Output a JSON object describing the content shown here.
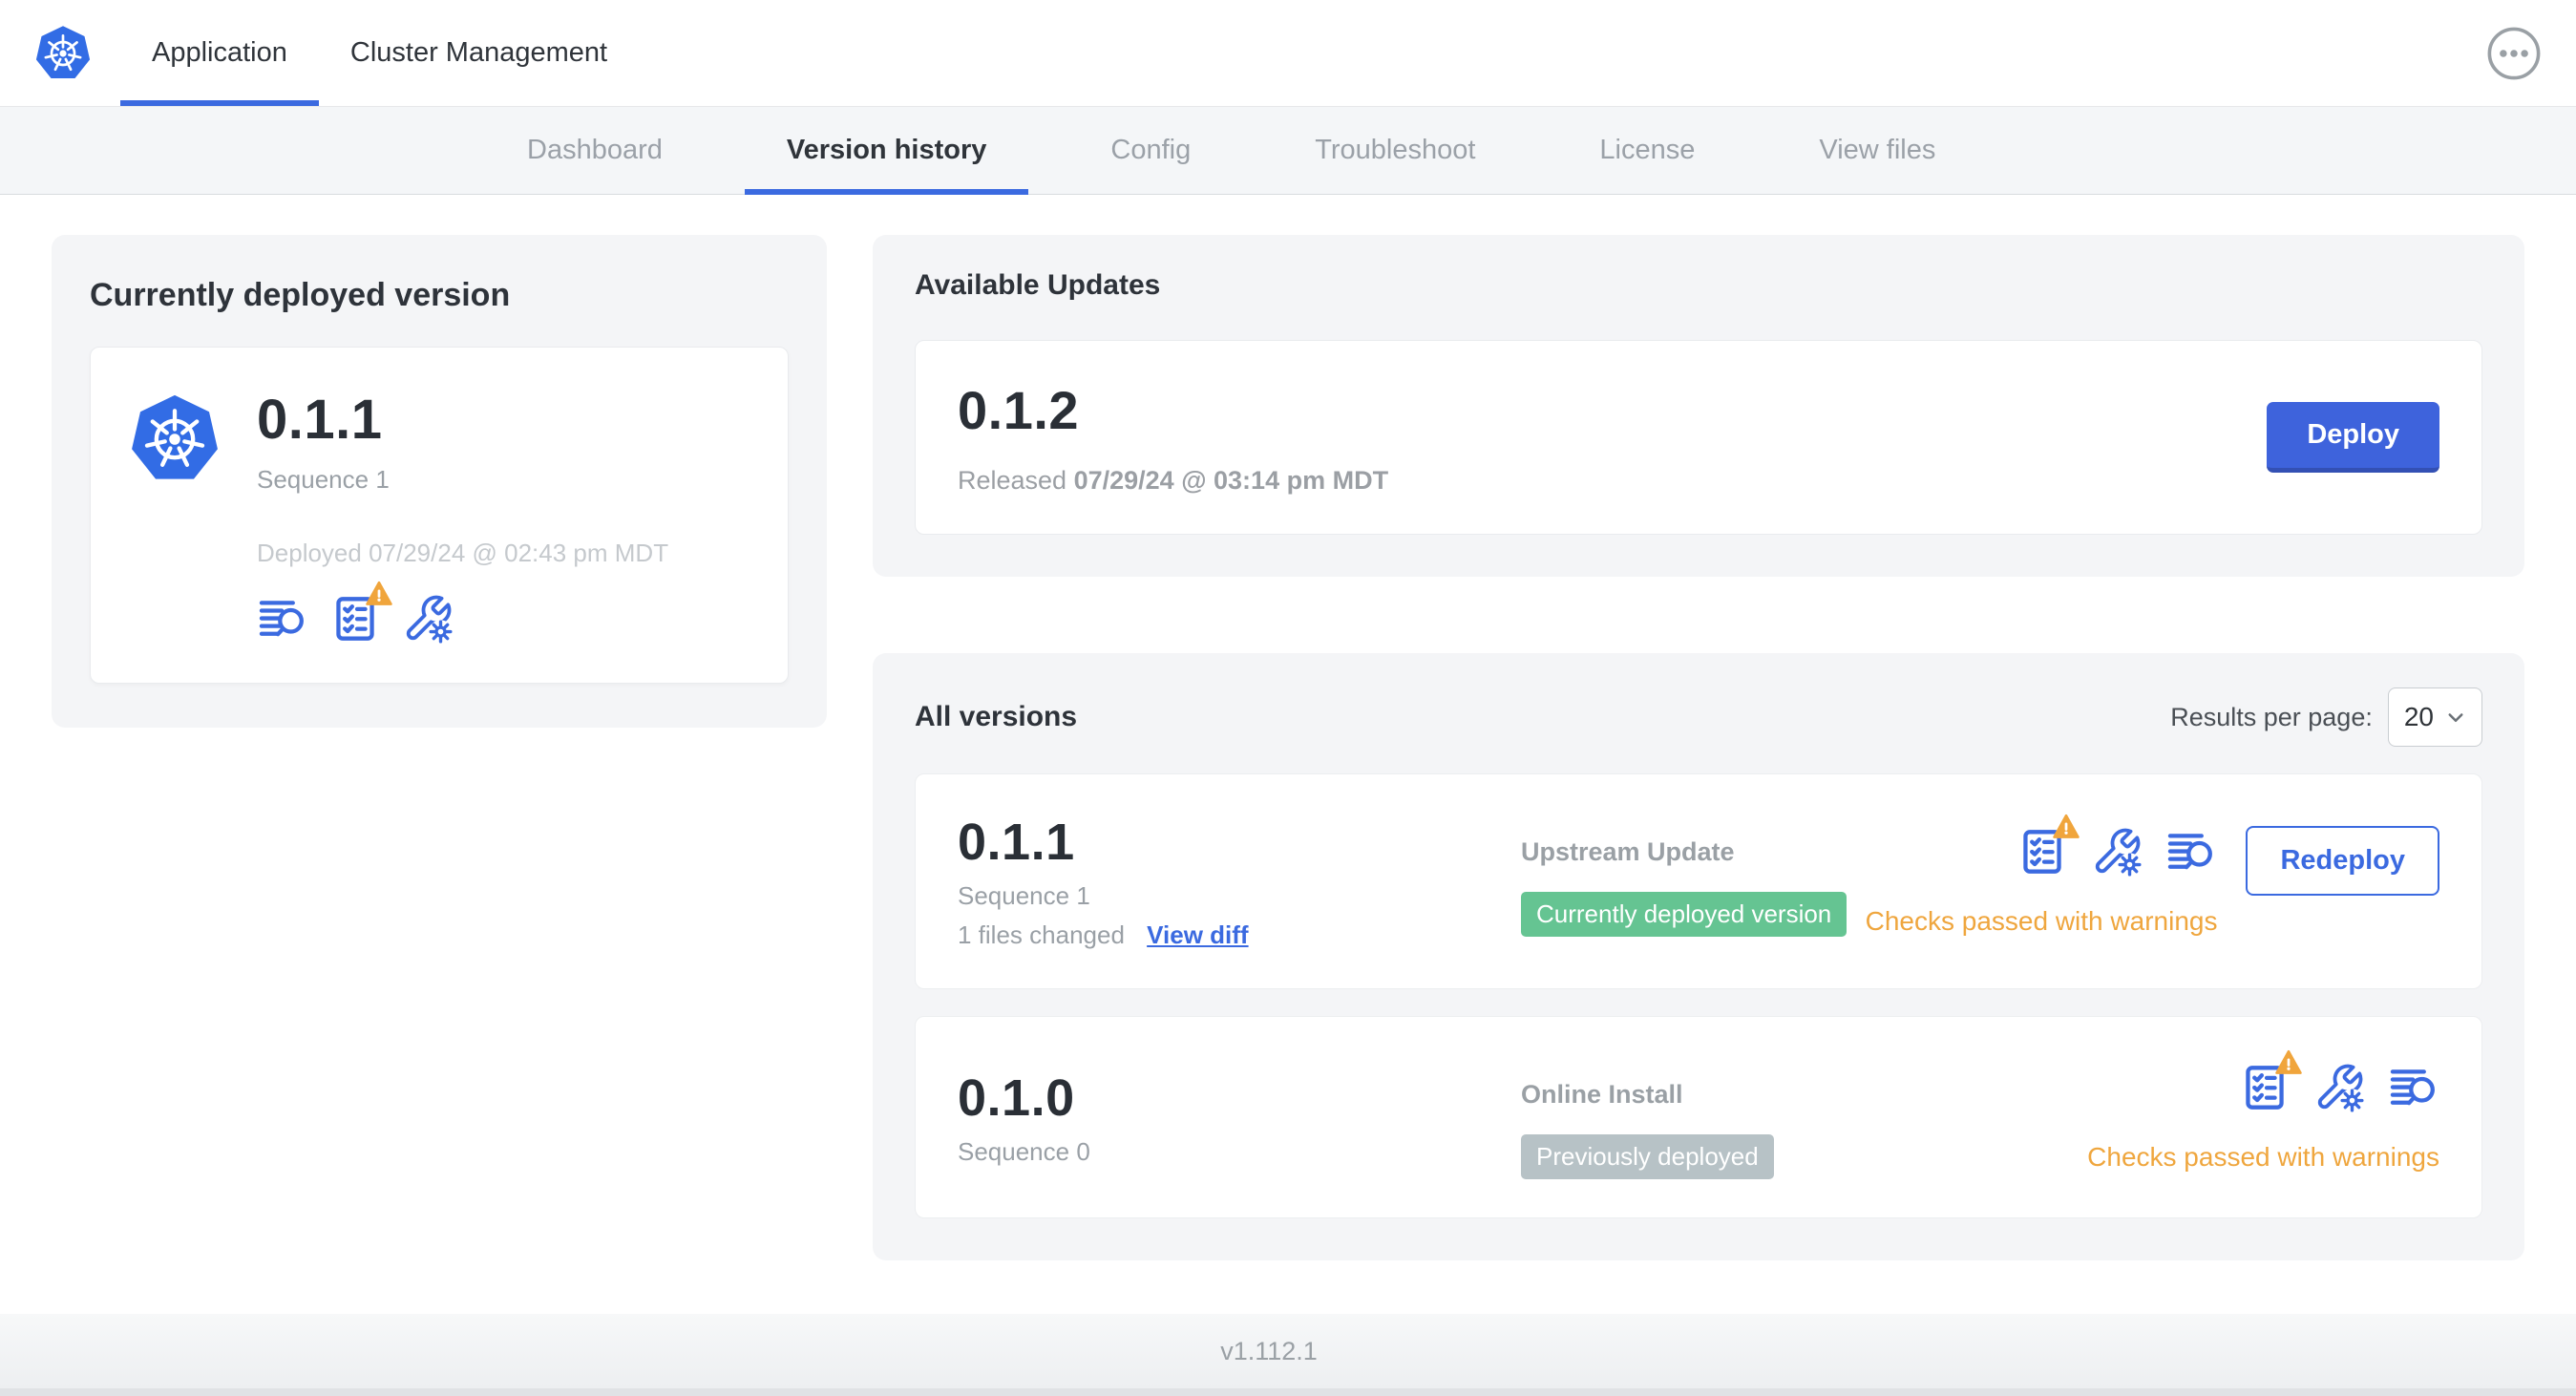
{
  "header": {
    "logo_icon": "kubernetes-logo",
    "tabs": [
      {
        "label": "Application",
        "active": true
      },
      {
        "label": "Cluster Management",
        "active": false
      }
    ],
    "menu_icon": "ellipsis-icon"
  },
  "subnav": {
    "tabs": [
      {
        "label": "Dashboard",
        "active": false
      },
      {
        "label": "Version history",
        "active": true
      },
      {
        "label": "Config",
        "active": false
      },
      {
        "label": "Troubleshoot",
        "active": false
      },
      {
        "label": "License",
        "active": false
      },
      {
        "label": "View files",
        "active": false
      }
    ]
  },
  "current_version_card": {
    "title": "Currently deployed version",
    "version": "0.1.1",
    "sequence": "Sequence 1",
    "deployed_at": "Deployed 07/29/24 @ 02:43 pm MDT",
    "icons": [
      "deploy-logs-icon",
      "preflight-checks-warning-icon",
      "config-icon"
    ]
  },
  "available_updates": {
    "title": "Available Updates",
    "update": {
      "version": "0.1.2",
      "released_label": "Released",
      "released_date": "07/29/24 @ 03:14 pm MDT",
      "deploy_label": "Deploy"
    }
  },
  "all_versions": {
    "title": "All versions",
    "results_per_page_label": "Results per page:",
    "results_per_page_value": "20",
    "versions": [
      {
        "version": "0.1.1",
        "sequence": "Sequence 1",
        "files_changed": "1 files changed",
        "view_diff_label": "View diff",
        "source": "Upstream Update",
        "status_badge": "Currently deployed version",
        "action_label": "Redeploy",
        "checks_text": "Checks passed with warnings",
        "icons": [
          "preflight-checks-warning-icon",
          "config-icon",
          "deploy-logs-icon"
        ]
      },
      {
        "version": "0.1.0",
        "sequence": "Sequence 0",
        "source": "Online Install",
        "status_badge": "Previously deployed",
        "checks_text": "Checks passed with warnings",
        "icons": [
          "preflight-checks-warning-icon",
          "config-icon",
          "deploy-logs-icon"
        ]
      }
    ]
  },
  "footer": {
    "app_version": "v1.112.1"
  },
  "colors": {
    "accent_blue": "#3b6ae0",
    "kubernetes_blue": "#326ce5",
    "badge_green": "#65c492",
    "badge_gray": "#b7c2c6",
    "warning_orange": "#f0a53c",
    "checks_warning_text": "#efa63e",
    "card_background": "#f4f5f7",
    "subnav_background": "#f4f6f8"
  }
}
